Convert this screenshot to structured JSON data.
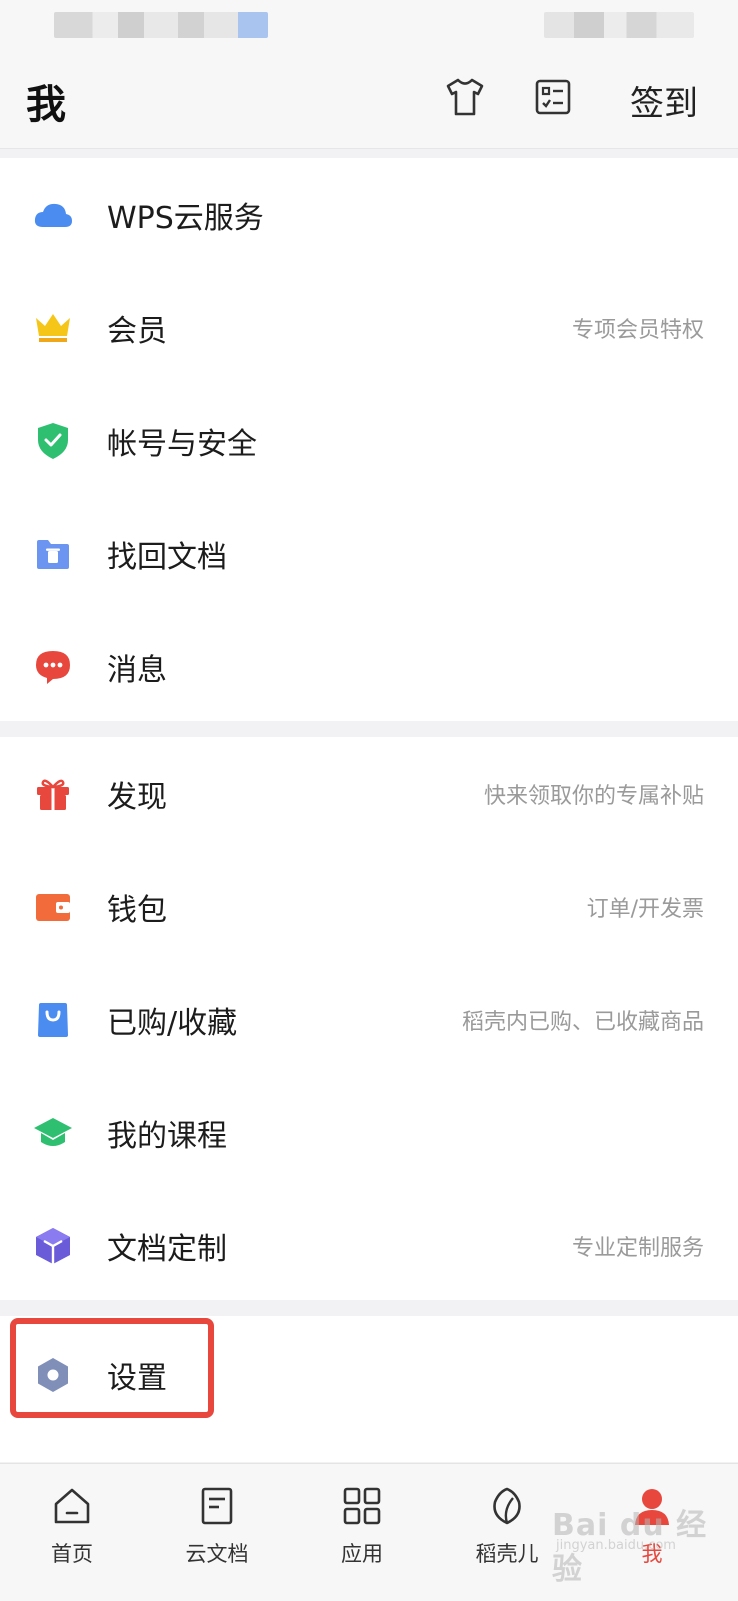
{
  "header": {
    "title": "我",
    "checkin_label": "签到",
    "icons": [
      "shirt-icon",
      "checklist-icon"
    ]
  },
  "sections": [
    {
      "items": [
        {
          "name": "wps-cloud",
          "label": "WPS云服务",
          "desc": "",
          "icon": "cloud-icon",
          "color": "#4a8cf0"
        },
        {
          "name": "member",
          "label": "会员",
          "desc": "专项会员特权",
          "icon": "crown-icon",
          "color": "#f5c518"
        },
        {
          "name": "account-security",
          "label": "帐号与安全",
          "desc": "",
          "icon": "shield-icon",
          "color": "#2fbf71"
        },
        {
          "name": "recover-docs",
          "label": "找回文档",
          "desc": "",
          "icon": "folder-trash-icon",
          "color": "#5b8ef6"
        },
        {
          "name": "messages",
          "label": "消息",
          "desc": "",
          "icon": "chat-bubble-icon",
          "color": "#e8473d"
        }
      ]
    },
    {
      "items": [
        {
          "name": "discover",
          "label": "发现",
          "desc": "快来领取你的专属补贴",
          "icon": "gift-icon",
          "color": "#e8473d"
        },
        {
          "name": "wallet",
          "label": "钱包",
          "desc": "订单/开发票",
          "icon": "wallet-icon",
          "color": "#f26b3a"
        },
        {
          "name": "purchased-favorites",
          "label": "已购/收藏",
          "desc": "稻壳内已购、已收藏商品",
          "icon": "shopping-bag-icon",
          "color": "#4a8cf0"
        },
        {
          "name": "my-courses",
          "label": "我的课程",
          "desc": "",
          "icon": "graduation-cap-icon",
          "color": "#2fbf71"
        },
        {
          "name": "doc-customization",
          "label": "文档定制",
          "desc": "专业定制服务",
          "icon": "cube-icon",
          "color": "#6a5bd8"
        }
      ]
    },
    {
      "items": [
        {
          "name": "settings",
          "label": "设置",
          "desc": "",
          "icon": "hexagon-gear-icon",
          "color": "#7f8fb8"
        }
      ]
    }
  ],
  "bottom_nav": [
    {
      "name": "home",
      "label": "首页",
      "icon": "home-icon",
      "active": false
    },
    {
      "name": "cloud-docs",
      "label": "云文档",
      "icon": "document-icon",
      "active": false
    },
    {
      "name": "apps",
      "label": "应用",
      "icon": "grid-icon",
      "active": false
    },
    {
      "name": "docer",
      "label": "稻壳儿",
      "icon": "leaf-icon",
      "active": false
    },
    {
      "name": "me",
      "label": "我",
      "icon": "person-icon",
      "active": true
    }
  ],
  "colors": {
    "accent": "#e8473d",
    "highlight_box": "#e8473d"
  },
  "watermark": {
    "text": "Bai du 经验",
    "sub": "jingyan.baidu.com"
  }
}
